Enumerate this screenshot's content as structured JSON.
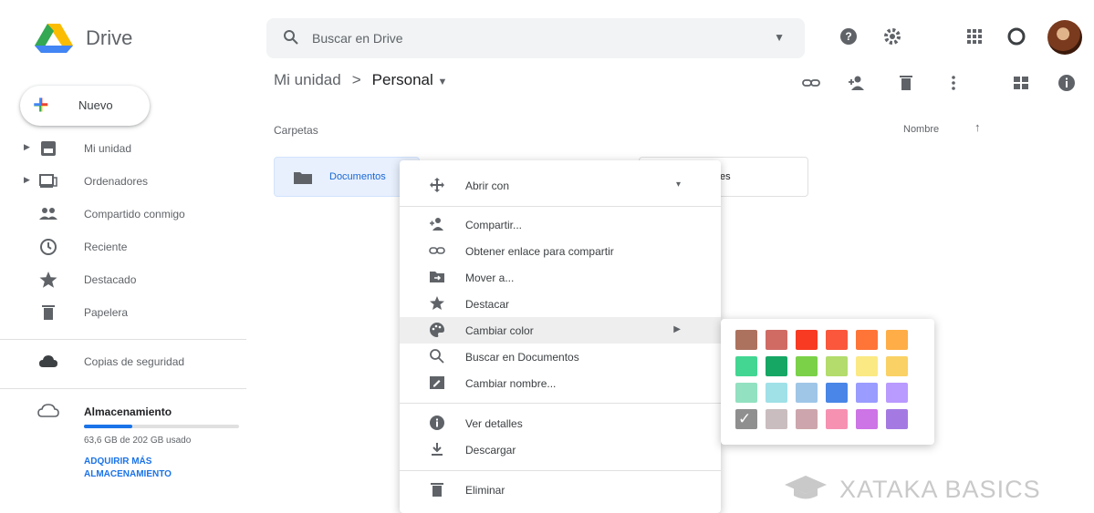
{
  "app": {
    "name": "Drive"
  },
  "search": {
    "placeholder": "Buscar en Drive"
  },
  "sidebar": {
    "new_label": "Nuevo",
    "items": [
      {
        "label": "Mi unidad",
        "icon": "drive-icon"
      },
      {
        "label": "Ordenadores",
        "icon": "computer-icon"
      },
      {
        "label": "Compartido conmigo",
        "icon": "shared-icon"
      },
      {
        "label": "Reciente",
        "icon": "clock-icon"
      },
      {
        "label": "Destacado",
        "icon": "star-icon"
      },
      {
        "label": "Papelera",
        "icon": "trash-icon"
      }
    ],
    "backup_label": "Copias de seguridad",
    "storage": {
      "title": "Almacenamiento",
      "usage": "63,6 GB de 202 GB usado",
      "fill": 0.31,
      "upgrade_link": "ADQUIRIR MÁS ALMACENAMIENTO"
    }
  },
  "breadcrumb": {
    "root": "Mi unidad",
    "separator": ">",
    "current": "Personal"
  },
  "main": {
    "section_label": "Carpetas",
    "sort_label": "Nombre",
    "folder_name": "Documentos",
    "folder2_suffix": "es"
  },
  "context_menu": {
    "items": [
      {
        "label": "Abrir con",
        "icon": "open-with-icon",
        "submenu": true
      },
      {
        "label": "Compartir...",
        "icon": "share-icon"
      },
      {
        "label": "Obtener enlace para compartir",
        "icon": "link-icon"
      },
      {
        "label": "Mover a...",
        "icon": "move-icon"
      },
      {
        "label": "Destacar",
        "icon": "star-icon"
      },
      {
        "label": "Cambiar color",
        "icon": "palette-icon",
        "submenu": true,
        "highlighted": true
      },
      {
        "label": "Buscar en Documentos",
        "icon": "search-icon"
      },
      {
        "label": "Cambiar nombre...",
        "icon": "rename-icon"
      },
      {
        "label": "Ver detalles",
        "icon": "info-icon"
      },
      {
        "label": "Descargar",
        "icon": "download-icon"
      },
      {
        "label": "Eliminar",
        "icon": "trash-icon"
      }
    ]
  },
  "palette": {
    "colors": [
      [
        "#ac725e",
        "#d06b64",
        "#f83a22",
        "#fa573c",
        "#ff7537",
        "#ffad46"
      ],
      [
        "#42d692",
        "#16a765",
        "#7bd148",
        "#b3dc6c",
        "#fbe983",
        "#fad165"
      ],
      [
        "#92e1c0",
        "#9fe1e7",
        "#9fc6e7",
        "#4986e7",
        "#9a9cff",
        "#b99aff"
      ],
      [
        "#8f8f8f",
        "#cabdbf",
        "#cca6ac",
        "#f691b2",
        "#cd74e6",
        "#a47ae2"
      ]
    ],
    "selected": [
      3,
      0
    ]
  },
  "watermark": {
    "text": "XATAKA BASICS"
  }
}
